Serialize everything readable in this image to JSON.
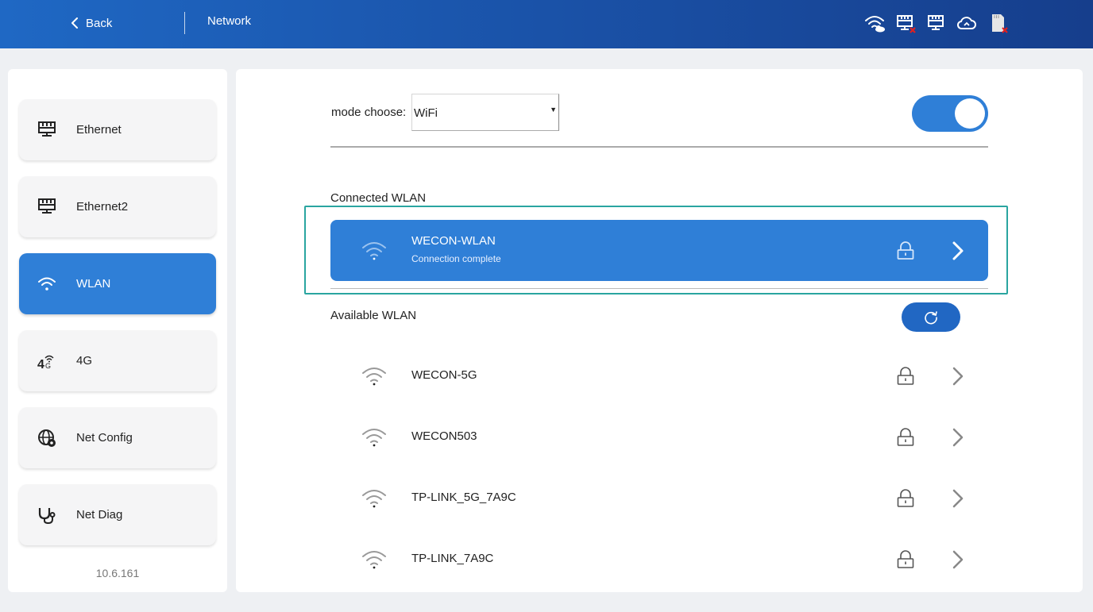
{
  "header": {
    "back_label": "Back",
    "title": "Network",
    "status_icons": [
      "wifi-cloud-icon",
      "ethernet-error-icon",
      "ethernet-icon",
      "cloud-icon",
      "sd-card-error-icon"
    ]
  },
  "sidebar": {
    "items": [
      {
        "label": "Ethernet",
        "icon": "ethernet-icon",
        "active": false
      },
      {
        "label": "Ethernet2",
        "icon": "ethernet-icon",
        "active": false
      },
      {
        "label": "WLAN",
        "icon": "wifi-icon",
        "active": true
      },
      {
        "label": "4G",
        "icon": "cellular-4g-icon",
        "active": false
      },
      {
        "label": "Net Config",
        "icon": "globe-gear-icon",
        "active": false
      },
      {
        "label": "Net Diag",
        "icon": "stethoscope-icon",
        "active": false
      }
    ],
    "version": "10.6.161"
  },
  "main": {
    "mode_label": "mode choose:",
    "mode_value": "WiFi",
    "toggle_on": true,
    "connected_label": "Connected WLAN",
    "connected": {
      "ssid": "WECON-WLAN",
      "status": "Connection complete"
    },
    "available_label": "Available WLAN",
    "available": [
      {
        "ssid": "WECON-5G"
      },
      {
        "ssid": "WECON503"
      },
      {
        "ssid": "TP-LINK_5G_7A9C"
      },
      {
        "ssid": "TP-LINK_7A9C"
      }
    ]
  },
  "colors": {
    "accent": "#2f7fd7",
    "header_start": "#1f68c4",
    "header_end": "#163e8c",
    "error_badge": "#e02020",
    "highlight_border": "#2aa5a0"
  }
}
